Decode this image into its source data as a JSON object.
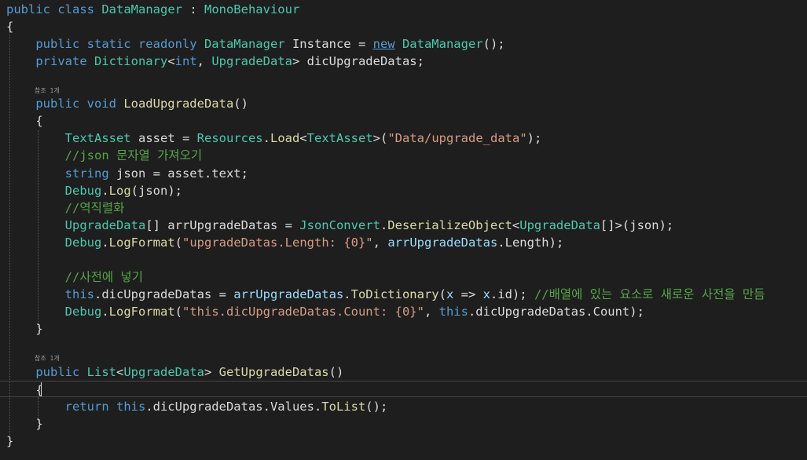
{
  "ref_hint": "참조 1개",
  "lines": [
    {
      "tokens": [
        {
          "t": "public class ",
          "c": "kw"
        },
        {
          "t": "DataManager",
          "c": "ty"
        },
        {
          "t": " : ",
          "c": "id"
        },
        {
          "t": "MonoBehaviour",
          "c": "ty"
        }
      ]
    },
    {
      "tokens": [
        {
          "t": "{",
          "c": "id"
        }
      ]
    },
    {
      "tokens": [
        {
          "t": "    public static readonly ",
          "c": "kw"
        },
        {
          "t": "DataManager",
          "c": "ty"
        },
        {
          "t": " Instance = ",
          "c": "id"
        },
        {
          "t": "new",
          "c": "nw"
        },
        {
          "t": " ",
          "c": "id"
        },
        {
          "t": "DataManager",
          "c": "ty"
        },
        {
          "t": "();",
          "c": "id"
        }
      ]
    },
    {
      "tokens": [
        {
          "t": "    private ",
          "c": "kw"
        },
        {
          "t": "Dictionary",
          "c": "ty"
        },
        {
          "t": "<",
          "c": "id"
        },
        {
          "t": "int",
          "c": "kw"
        },
        {
          "t": ", ",
          "c": "id"
        },
        {
          "t": "UpgradeData",
          "c": "ty"
        },
        {
          "t": "> dicUpgradeDatas;",
          "c": "id"
        }
      ]
    },
    {
      "tokens": []
    },
    {
      "tokens": [
        {
          "t": "    public void ",
          "c": "kw"
        },
        {
          "t": "LoadUpgradeData",
          "c": "mt"
        },
        {
          "t": "()",
          "c": "id"
        }
      ]
    },
    {
      "tokens": [
        {
          "t": "    {",
          "c": "id"
        }
      ]
    },
    {
      "tokens": [
        {
          "t": "        ",
          "c": "id"
        },
        {
          "t": "TextAsset",
          "c": "ty"
        },
        {
          "t": " asset = ",
          "c": "id"
        },
        {
          "t": "Resources",
          "c": "ty"
        },
        {
          "t": ".",
          "c": "id"
        },
        {
          "t": "Load",
          "c": "mt"
        },
        {
          "t": "<",
          "c": "id"
        },
        {
          "t": "TextAsset",
          "c": "ty"
        },
        {
          "t": ">(",
          "c": "id"
        },
        {
          "t": "\"Data/upgrade_data\"",
          "c": "st"
        },
        {
          "t": ");",
          "c": "id"
        }
      ]
    },
    {
      "tokens": [
        {
          "t": "        //json 문자열 가져오기",
          "c": "cm"
        }
      ]
    },
    {
      "tokens": [
        {
          "t": "        ",
          "c": "id"
        },
        {
          "t": "string",
          "c": "kw"
        },
        {
          "t": " json = asset.text;",
          "c": "id"
        }
      ]
    },
    {
      "tokens": [
        {
          "t": "        ",
          "c": "id"
        },
        {
          "t": "Debug",
          "c": "ty"
        },
        {
          "t": ".",
          "c": "id"
        },
        {
          "t": "Log",
          "c": "mt"
        },
        {
          "t": "(json);",
          "c": "id"
        }
      ]
    },
    {
      "tokens": [
        {
          "t": "        //역직렬화",
          "c": "cm"
        }
      ]
    },
    {
      "tokens": [
        {
          "t": "        ",
          "c": "id"
        },
        {
          "t": "UpgradeData",
          "c": "ty"
        },
        {
          "t": "[] arrUpgradeDatas = ",
          "c": "id"
        },
        {
          "t": "JsonConvert",
          "c": "ty"
        },
        {
          "t": ".",
          "c": "id"
        },
        {
          "t": "DeserializeObject",
          "c": "mt"
        },
        {
          "t": "<",
          "c": "id"
        },
        {
          "t": "UpgradeData",
          "c": "ty"
        },
        {
          "t": "[]>(json);",
          "c": "id"
        }
      ]
    },
    {
      "tokens": [
        {
          "t": "        ",
          "c": "id"
        },
        {
          "t": "Debug",
          "c": "ty"
        },
        {
          "t": ".",
          "c": "id"
        },
        {
          "t": "LogFormat",
          "c": "mt"
        },
        {
          "t": "(",
          "c": "id"
        },
        {
          "t": "\"upgradeDatas.Length: {0}\"",
          "c": "st"
        },
        {
          "t": ", ",
          "c": "id"
        },
        {
          "t": "arrUpgradeDatas",
          "c": "pm"
        },
        {
          "t": ".Length);",
          "c": "id"
        }
      ]
    },
    {
      "tokens": []
    },
    {
      "tokens": [
        {
          "t": "        //사전에 넣기",
          "c": "cm"
        }
      ]
    },
    {
      "tokens": [
        {
          "t": "        ",
          "c": "id"
        },
        {
          "t": "this",
          "c": "kw"
        },
        {
          "t": ".dicUpgradeDatas = ",
          "c": "id"
        },
        {
          "t": "arrUpgradeDatas",
          "c": "pm"
        },
        {
          "t": ".",
          "c": "id"
        },
        {
          "t": "ToDictionary",
          "c": "mt"
        },
        {
          "t": "(",
          "c": "id"
        },
        {
          "t": "x",
          "c": "pm"
        },
        {
          "t": " => ",
          "c": "id"
        },
        {
          "t": "x",
          "c": "pm"
        },
        {
          "t": ".id); ",
          "c": "id"
        },
        {
          "t": "//배열에 있는 요소로 새로운 사전을 만듬",
          "c": "cm"
        }
      ]
    },
    {
      "tokens": [
        {
          "t": "        ",
          "c": "id"
        },
        {
          "t": "Debug",
          "c": "ty"
        },
        {
          "t": ".",
          "c": "id"
        },
        {
          "t": "LogFormat",
          "c": "mt"
        },
        {
          "t": "(",
          "c": "id"
        },
        {
          "t": "\"this.dicUpgradeDatas.Count: {0}\"",
          "c": "st"
        },
        {
          "t": ", ",
          "c": "id"
        },
        {
          "t": "this",
          "c": "kw"
        },
        {
          "t": ".dicUpgradeDatas.Count);",
          "c": "id"
        }
      ]
    },
    {
      "tokens": [
        {
          "t": "    }",
          "c": "id"
        }
      ]
    },
    {
      "tokens": []
    },
    {
      "tokens": [
        {
          "t": "    public ",
          "c": "kw"
        },
        {
          "t": "List",
          "c": "ty"
        },
        {
          "t": "<",
          "c": "id"
        },
        {
          "t": "UpgradeData",
          "c": "ty"
        },
        {
          "t": "> ",
          "c": "id"
        },
        {
          "t": "GetUpgradeDatas",
          "c": "mt"
        },
        {
          "t": "()",
          "c": "id"
        }
      ]
    },
    {
      "tokens": [
        {
          "t": "    {",
          "c": "id"
        }
      ]
    },
    {
      "tokens": [
        {
          "t": "        ",
          "c": "id"
        },
        {
          "t": "return ",
          "c": "kw"
        },
        {
          "t": "this",
          "c": "kw"
        },
        {
          "t": ".dicUpgradeDatas.Values.",
          "c": "id"
        },
        {
          "t": "ToList",
          "c": "mt"
        },
        {
          "t": "();",
          "c": "id"
        }
      ]
    },
    {
      "tokens": [
        {
          "t": "    }",
          "c": "id"
        }
      ]
    },
    {
      "tokens": [
        {
          "t": "}",
          "c": "id"
        }
      ]
    }
  ]
}
